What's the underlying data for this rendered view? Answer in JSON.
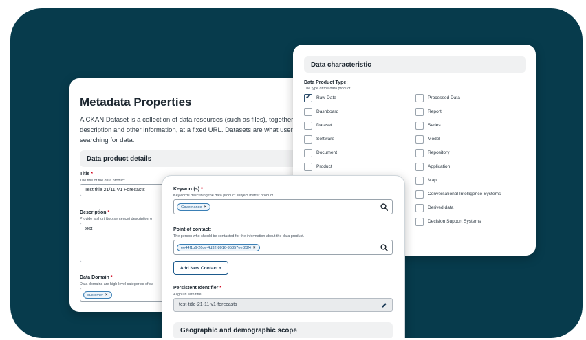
{
  "metadata": {
    "title": "Metadata Properties",
    "description_lines": [
      "A CKAN Dataset is a collection of data resources (such as files), together with a",
      "description and other information, at a fixed URL. Datasets are what users see wh",
      "searching for data."
    ],
    "section_title": "Data product details",
    "title_field": {
      "label": "Title",
      "required": "*",
      "hint": "The title of the data product.",
      "value": "Test title 21/11 V1  Forecasts"
    },
    "description_field": {
      "label": "Description",
      "required": "*",
      "hint": "Provide a short (two sentence) description o",
      "value": "test"
    },
    "domain_field": {
      "label": "Data Domain",
      "required": "*",
      "hint": "Data domains are high-level categories of da",
      "chip": "customer",
      "chip_x": "×"
    }
  },
  "characteristic": {
    "section_title": "Data characteristic",
    "type_label": "Data Product Type:",
    "type_hint": "The type of the data product.",
    "check_mark": "✓",
    "left_options": [
      {
        "label": "Raw Data",
        "checked": true
      },
      {
        "label": "Dashboard",
        "checked": false
      },
      {
        "label": "Dataset",
        "checked": false
      },
      {
        "label": "Software",
        "checked": false
      },
      {
        "label": "Document",
        "checked": false
      },
      {
        "label": "Product",
        "checked": false
      }
    ],
    "right_options": [
      {
        "label": "Processed Data",
        "checked": false
      },
      {
        "label": "Report",
        "checked": false
      },
      {
        "label": "Series",
        "checked": false
      },
      {
        "label": "Model",
        "checked": false
      },
      {
        "label": "Repository",
        "checked": false
      },
      {
        "label": "Application",
        "checked": false
      },
      {
        "label": "Map",
        "checked": false
      },
      {
        "label": "Conversational Intelligence Systems",
        "checked": false
      },
      {
        "label": "Derived data",
        "checked": false
      },
      {
        "label": "Decision Support Systems",
        "checked": false
      }
    ]
  },
  "keywords": {
    "label": "Keyword(s)",
    "required": "*",
    "hint": "Keywords describing the data product subject matter product.",
    "chip": "Governance",
    "chip_x": "×"
  },
  "contact": {
    "label": "Point of contact:",
    "hint": "The person who should be contacted for the information about the data product.",
    "chip": "ee44f1b6-26ce-4d32-8016-95857eef28f4",
    "chip_x": "×",
    "add_button": "Add New Contact +"
  },
  "identifier": {
    "label": "Persistent Identifier",
    "required": "*",
    "hint": "Align url with title.",
    "value": "test-title-21-11-v1-forecasts"
  },
  "geo_section_title": "Geographic and demographic scope",
  "colors": {
    "background": "#073b4c",
    "accent": "#1d5a8c",
    "required": "#d0021b"
  }
}
